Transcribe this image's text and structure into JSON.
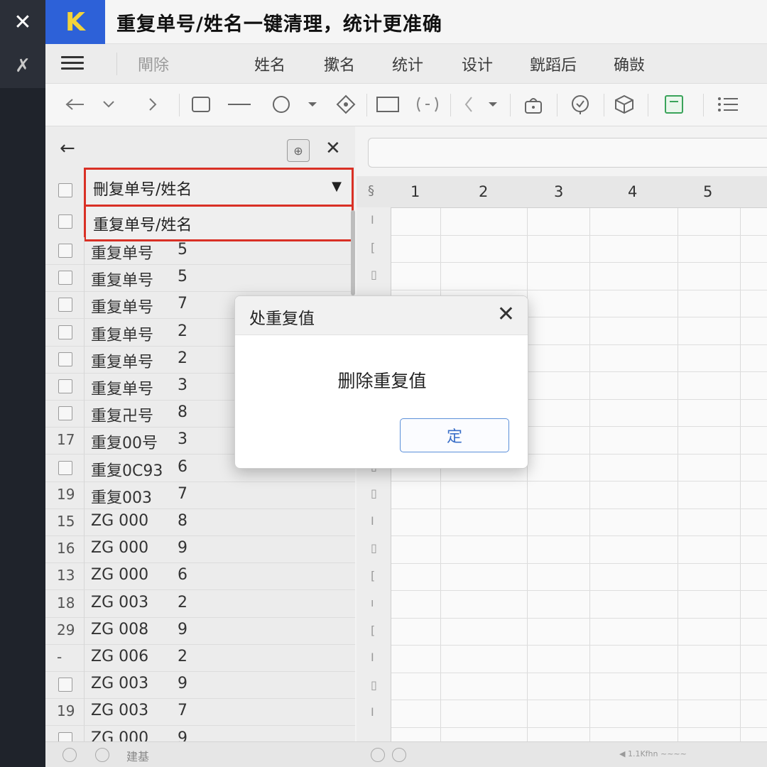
{
  "titlebar": {
    "close_glyph": "✕",
    "pin_glyph": "✗",
    "logo_letter": "K",
    "title": "重复单号/姓名一键清理，统计更准确"
  },
  "menu": [
    {
      "label": "閘除",
      "dim": true
    },
    {
      "label": "姓名",
      "dim": false
    },
    {
      "label": "擹名",
      "dim": false
    },
    {
      "label": "统计",
      "dim": false
    },
    {
      "label": "设计",
      "dim": false
    },
    {
      "label": "皝蹈后",
      "dim": false
    },
    {
      "label": "确敱",
      "dim": false
    }
  ],
  "toolbar_icons": [
    "arrow-left-icon",
    "chevron-down-icon",
    "arrow-right-icon",
    "rectangle-icon",
    "line-icon",
    "circle-icon",
    "dropdown-icon",
    "diamond-icon",
    "box-icon",
    "brackets-icon",
    "pointer-icon",
    "dropdown-icon",
    "lock-icon",
    "refresh-icon",
    "cube-icon",
    "green-square-icon",
    "list-icon"
  ],
  "panel": {
    "back_glyph": "←",
    "globe_glyph": "⊕",
    "close_glyph": "✕",
    "header_dropdown": "刪复单号/姓名",
    "header_arrow": "▼",
    "sub_header": "重复单号/姓名",
    "rows": [
      {
        "idx": "",
        "name": "重复单号",
        "val": "5"
      },
      {
        "idx": "",
        "name": "重复单号",
        "val": "5"
      },
      {
        "idx": "",
        "name": "重复单号",
        "val": "7"
      },
      {
        "idx": "",
        "name": "重复单号",
        "val": "2"
      },
      {
        "idx": "",
        "name": "重复单号",
        "val": "2"
      },
      {
        "idx": "",
        "name": "重复单号",
        "val": "3"
      },
      {
        "idx": "",
        "name": "重复卍号",
        "val": "8"
      },
      {
        "idx": "17",
        "name": "重复00号",
        "val": "3"
      },
      {
        "idx": "",
        "name": "重复0C93",
        "val": "6"
      },
      {
        "idx": "19",
        "name": "重复003",
        "val": "7"
      },
      {
        "idx": "15",
        "name": "ZG 000",
        "val": "8"
      },
      {
        "idx": "16",
        "name": "ZG 000",
        "val": "9"
      },
      {
        "idx": "13",
        "name": "ZG 000",
        "val": "6"
      },
      {
        "idx": "18",
        "name": "ZG 003",
        "val": "2"
      },
      {
        "idx": "29",
        "name": "ZG 008",
        "val": "9"
      },
      {
        "idx": "-",
        "name": "ZG 006",
        "val": "2"
      },
      {
        "idx": "",
        "name": "ZG 003",
        "val": "9"
      },
      {
        "idx": "19",
        "name": "ZG 003",
        "val": "7"
      },
      {
        "idx": "",
        "name": "ZG 000",
        "val": "9"
      }
    ]
  },
  "sheet": {
    "corner": "§",
    "columns": [
      "1",
      "2",
      "3",
      "4",
      "5"
    ],
    "row_marks": [
      "I",
      "[",
      "▯",
      "",
      "",
      "",
      "",
      "",
      "",
      "▯",
      "▯",
      "I",
      "▯",
      "[",
      "ı",
      "[",
      "I",
      "▯",
      "I"
    ]
  },
  "status": {
    "left_text": "建基",
    "mid_text": "◀ 1.1Kfhn ~~~~"
  },
  "dialog": {
    "title": "处重复值",
    "close_glyph": "✕",
    "message": "删除重复值",
    "ok_label": "定"
  }
}
